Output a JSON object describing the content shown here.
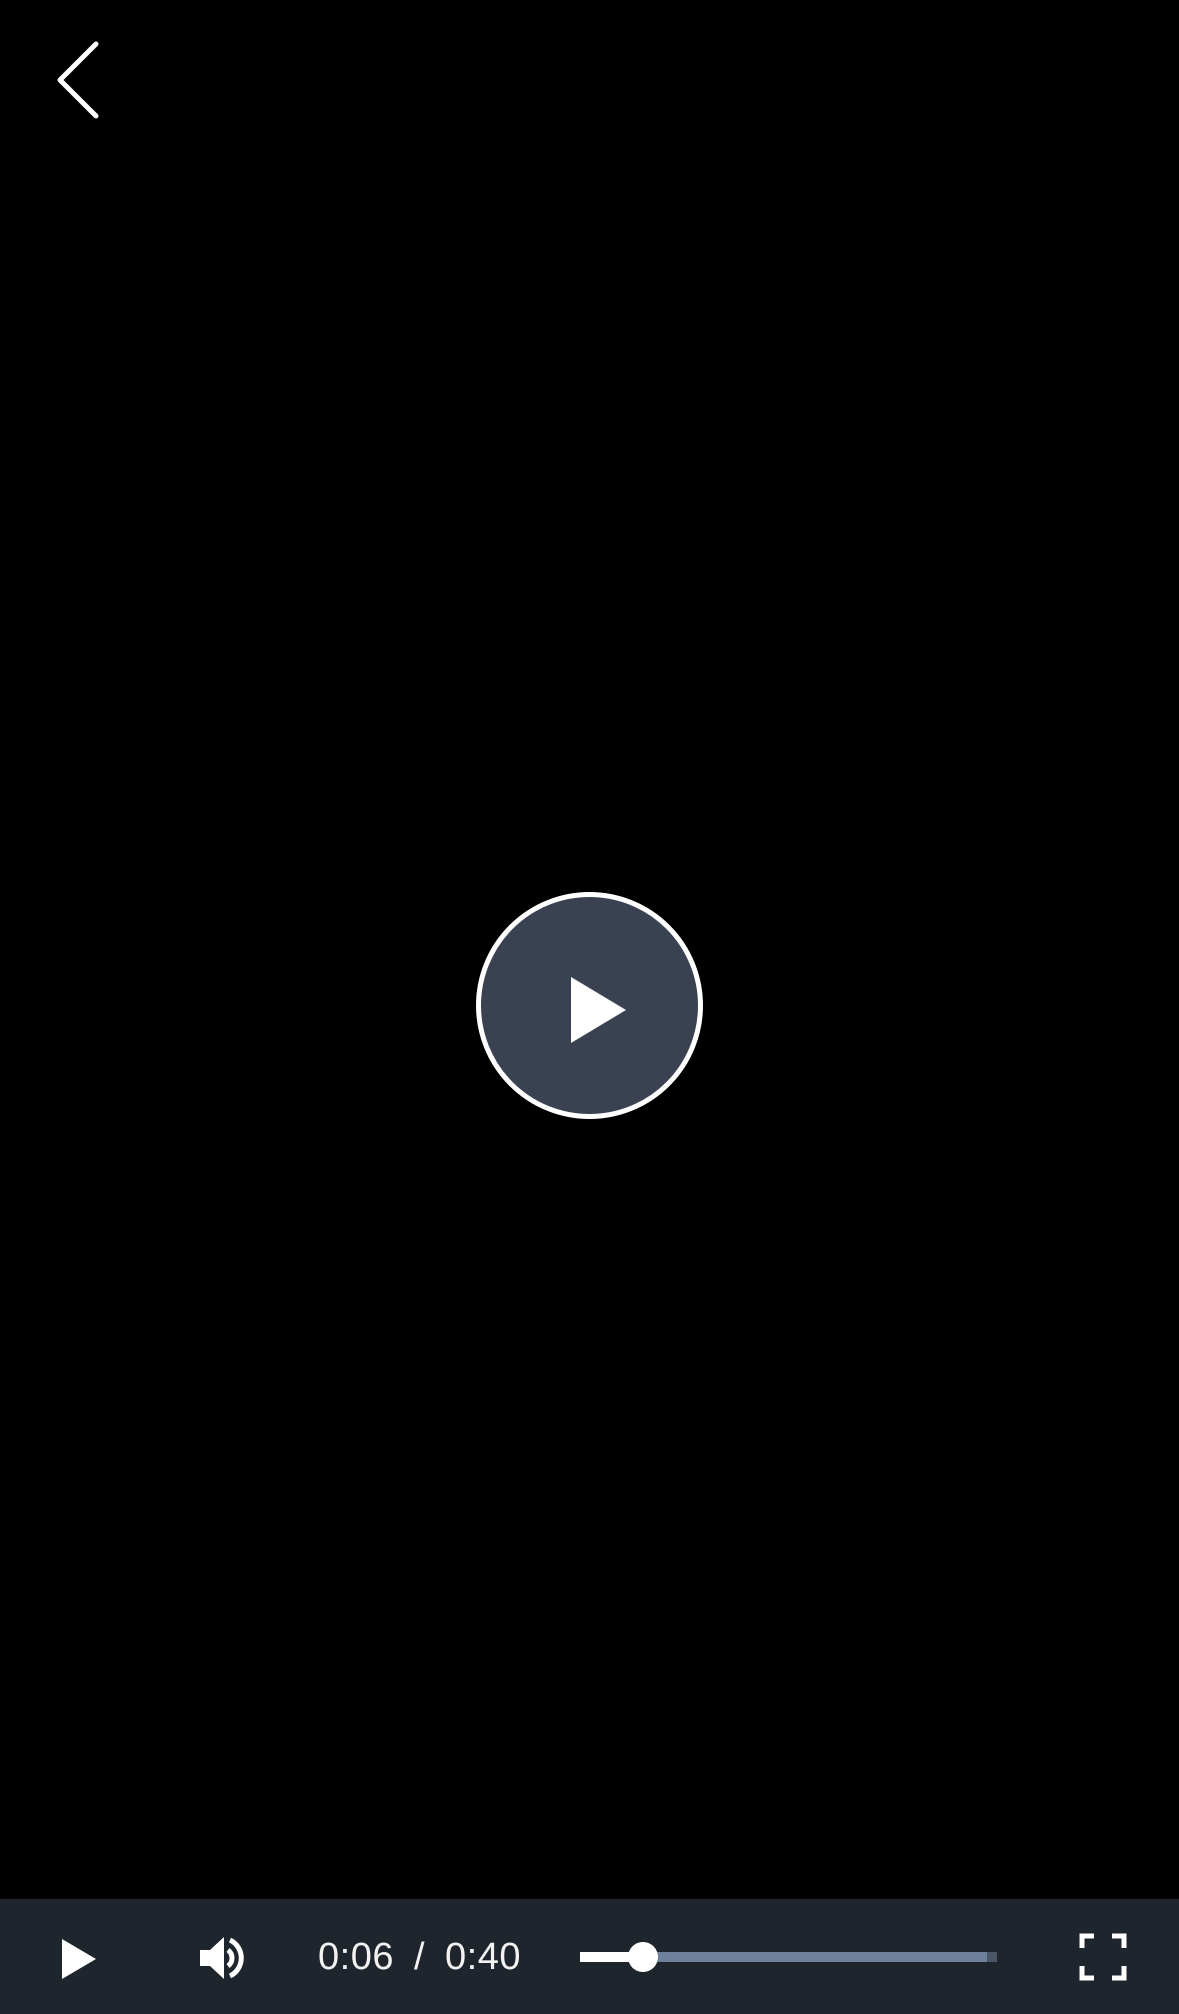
{
  "player": {
    "current_time": "0:06",
    "separator": "/",
    "duration": "0:40",
    "progress_fraction": 0.15
  },
  "icons": {
    "back": "chevron-left-icon",
    "center_play": "play-icon",
    "play": "play-icon",
    "volume": "volume-icon",
    "fullscreen": "fullscreen-icon"
  },
  "colors": {
    "background": "#000000",
    "control_bar": "#1f252d",
    "center_button": "#3a4252",
    "progress_track": "#6e819a",
    "progress_fill": "#ffffff"
  }
}
